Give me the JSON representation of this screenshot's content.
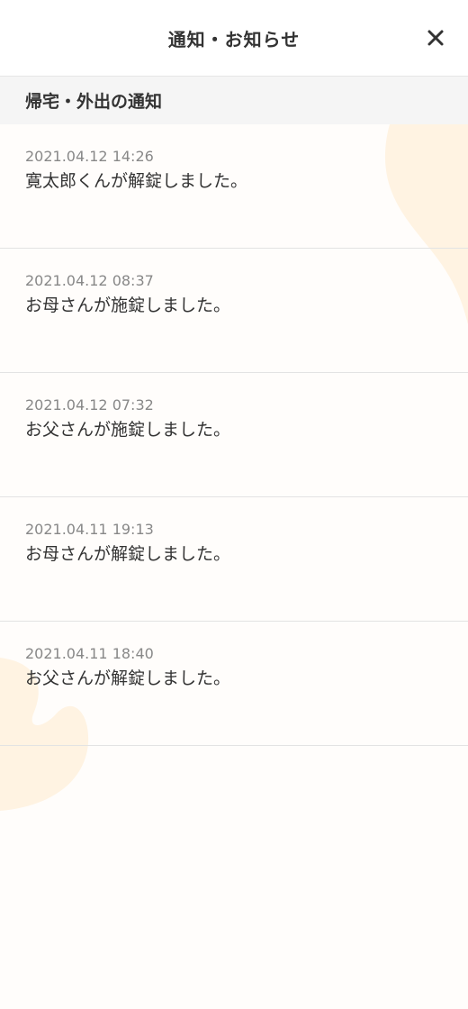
{
  "header": {
    "title": "通知・お知らせ",
    "close_icon": "close-icon"
  },
  "section": {
    "title": "帰宅・外出の通知"
  },
  "notifications": [
    {
      "time": "2021.04.12 14:26",
      "message": "寛太郎くんが解錠しました。"
    },
    {
      "time": "2021.04.12 08:37",
      "message": "お母さんが施錠しました。"
    },
    {
      "time": "2021.04.12 07:32",
      "message": "お父さんが施錠しました。"
    },
    {
      "time": "2021.04.11 19:13",
      "message": "お母さんが解錠しました。"
    },
    {
      "time": "2021.04.11 18:40",
      "message": "お父さんが解錠しました。"
    }
  ],
  "colors": {
    "background": "#fffdfb",
    "blob": "#fff3e2",
    "section_bg": "#f5f5f5",
    "text": "#333333",
    "subtext": "#888888",
    "divider": "#e3e3e3"
  }
}
